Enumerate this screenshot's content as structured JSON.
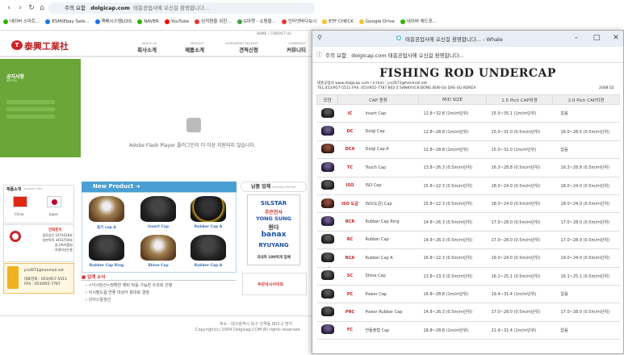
{
  "browser": {
    "address": "dolgicap.com",
    "tab_title": "태흥공업사에 오신걸 환영합니다...",
    "site_label": "주의 요함",
    "bookmarks": [
      {
        "label": "네이버 스마트...",
        "color": "#2db400"
      },
      {
        "label": "ESM(Ebay Sale...",
        "color": "#1a73e8"
      },
      {
        "label": "핵배시스템LOIS",
        "color": "#1a73e8"
      },
      {
        "label": "NAVER",
        "color": "#2db400"
      },
      {
        "label": "YouTube",
        "color": "#ff0000"
      },
      {
        "label": "임직원을 위한...",
        "color": "#e53935"
      },
      {
        "label": "G마켓 - 쇼핑을...",
        "color": "#43a047"
      },
      {
        "label": "인터넷바다보시",
        "color": "#e53935"
      },
      {
        "label": "ETF CHECK",
        "color": "#fbc02d"
      },
      {
        "label": "Google Drive",
        "color": "#fbc02d"
      },
      {
        "label": "네이버 애드포...",
        "color": "#2db400"
      }
    ]
  },
  "site": {
    "logo": "泰興工業社",
    "top_links": "HOME  • CONTACT US",
    "menu": [
      {
        "sub": "ABOUT US",
        "label": "회사소개"
      },
      {
        "sub": "PRODUCT",
        "label": "제품소개"
      },
      {
        "sub": "ESSESSMENT REQUEST",
        "label": "견적신청"
      },
      {
        "sub": "COMMUNITY",
        "label": "커뮤니티"
      }
    ],
    "notice_title": "공지사항",
    "notice_sub": "NOTICE",
    "flash_message": "Adobe Flash Player 플러그인이 더 이상 지원되지 않습니다.",
    "product_intro": "제품소개",
    "product_intro_sub": "product intro",
    "flags": [
      "China",
      "Japan"
    ],
    "phone_box": "전화문의",
    "phone_lines": [
      "설정상인 1074418호",
      "일본특허 3453704호",
      "중국특허출원",
      "저렴여성은층"
    ],
    "contact_email": "jcs2673@hanmail.net",
    "contact_phone": "대표전화 : 053)957-5511",
    "contact_fax": "FAX : 053)955-7787",
    "new_product_title": "New Product",
    "products": [
      "동기 cap A",
      "Insert Cap",
      "Rubber Cap A",
      "Rubber Cap Ring",
      "Shine Cap",
      "Rubber Cap A"
    ],
    "news_title": "업계 소식",
    "news": [
      "<낙시탄산>정확한 채비 비를 가능한 수조회 선행",
      "낚시필드컵 연좋 대상어 붕대로 결정",
      "낚어스탈생산"
    ],
    "partner_title": "납품 업체",
    "partner_sub": "Business Partner",
    "partners": [
      "SILSTAR",
      "주은안사",
      "YONG SUNG",
      "원다",
      "banax",
      "RYUYANG",
      "국내외 100여개 업체"
    ],
    "partner_ad": "주은낚시사이트",
    "footer_line1": "주소 : 대구광역시 북구 산격동 802-2 번지",
    "footer_line2": "Copyright(c) 2004 Dolgicap.COM All rights reserved."
  },
  "whale": {
    "title": "태흥공업사에 오신걸 환영합니다... - Whale",
    "site_label": "주의 요함",
    "address": "dolgicap.com 태흥공업사에 오신걸 환영합니다...",
    "page_title": "FISHING ROD UNDERCAP",
    "info_line1": "태흥공업사 www.dolgicap.com / e-mail : jcs2673@hanmail.net",
    "info_line2": "TEL.053)957-5511  FAX. 053)955-7787  802-2 SANKYUCK-DONG BUK-GU DAE-GU KOREA",
    "date": "2008.02",
    "table_headers": [
      "모양",
      "CAP 종류",
      "M/D SIZE",
      "1.5 Pich CAP외경",
      "2.0 Pich CAP외경"
    ],
    "rows": [
      {
        "code": "IC",
        "name": "Insert Cap",
        "size": "12.8~32.8 (1m/m단위)",
        "p15": "15.0~35.1 (1m/m단위)",
        "p20": "없음",
        "tint": "dark"
      },
      {
        "code": "DC",
        "name": "Dolgi Cap",
        "size": "12.8~28.8 (1m/m단위)",
        "p15": "15.0~31.0 (0.5m/m단위)",
        "p20": "16.0~28.5 (0.5m/m단위)",
        "tint": "purple"
      },
      {
        "code": "DCA",
        "name": "Dolgi Cap A",
        "size": "12.8~28.8 (1m/m단위)",
        "p15": "15.0~31.0 (1m/m단위)",
        "p20": "없음",
        "tint": "red"
      },
      {
        "code": "TC",
        "name": "Touch Cap",
        "size": "13.8~26.3 (0.5m/m단위)",
        "p15": "16.3~28.8 (0.5m/m단위)",
        "p20": "16.3~28.8 (0.5m/m단위)",
        "tint": "purple"
      },
      {
        "code": "ISO",
        "name": "ISO Cap",
        "size": "15.8~22.3 (0.5m/m단위)",
        "p15": "18.0~24.0 (0.5m/m단위)",
        "p20": "18.0~24.0 (0.5m/m단위)",
        "tint": "dark"
      },
      {
        "code": "ISO 도금",
        "name": "ISO(도금) Cap",
        "size": "15.8~22.3 (0.5m/m단위)",
        "p15": "18.0~24.0 (0.5m/m단위)",
        "p20": "18.0~24.0 (0.5m/m단위)",
        "tint": "red"
      },
      {
        "code": "RCR",
        "name": "Rubber Cap Ring",
        "size": "14.8~26.3 (0.5m/m단위)",
        "p15": "17.0~28.0 (0.5m/m단위)",
        "p20": "17.0~28.0 (0.5m/m단위)",
        "tint": "purple"
      },
      {
        "code": "RC",
        "name": "Rubber Cap",
        "size": "14.8~26.3 (0.5m/m단위)",
        "p15": "17.0~28.0 (0.5m/m단위)",
        "p20": "17.0~28.0 (0.5m/m단위)",
        "tint": "dark"
      },
      {
        "code": "RCA",
        "name": "Rubber Cap A",
        "size": "16.8~22.3 (0.5m/m단위)",
        "p15": "19.0~24.0 (0.5m/m단위)",
        "p20": "19.0~24.0 (0.5m/m단위)",
        "tint": "dark"
      },
      {
        "code": "SC",
        "name": "Shine Cap",
        "size": "13.8~23.3 (0.5m/m단위)",
        "p15": "16.1~25.1 (0.5m/m단위)",
        "p20": "16.1~25.1 (0.5m/m단위)",
        "tint": "dark"
      },
      {
        "code": "PC",
        "name": "Power Cap",
        "size": "16.8~28.8 (1m/m단위)",
        "p15": "19.4~31.4 (1m/m단위)",
        "p20": "없음",
        "tint": "dark"
      },
      {
        "code": "PRC",
        "name": "Power Rubber Cap",
        "size": "14.8~26.3 (0.5m/m단위)",
        "p15": "17.0~28.0 (0.5m/m단위)",
        "p20": "17.0~28.0 (0.5m/m단위)",
        "tint": "dark"
      },
      {
        "code": "FC",
        "name": "연돌출캡 Cap",
        "size": "18.8~28.8 (1m/m단위)",
        "p15": "21.4~31.4 (1m/m단위)",
        "p20": "없음",
        "tint": "purple"
      }
    ]
  }
}
